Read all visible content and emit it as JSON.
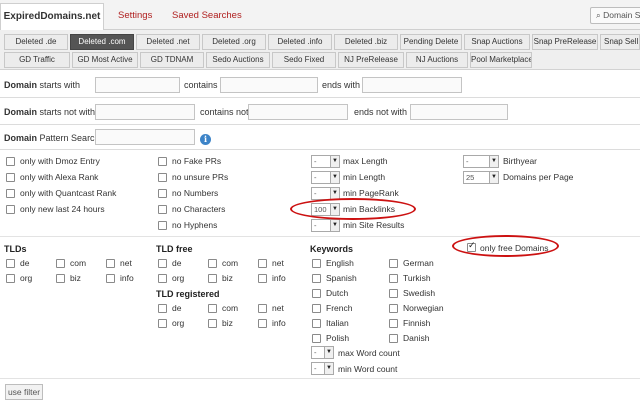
{
  "header": {
    "brand": "ExpiredDomains.net",
    "settings": "Settings",
    "saved_searches": "Saved Searches",
    "domain_search": "Domain S"
  },
  "tabs_row1": [
    "Deleted .de",
    "Deleted .com",
    "Deleted .net",
    "Deleted .org",
    "Deleted .info",
    "Deleted .biz",
    "Pending Delete",
    "Snap Auctions",
    "Snap PreRelease",
    "Snap Sell"
  ],
  "tabs_row2": [
    "GD Traffic",
    "GD Most Active",
    "GD TDNAM",
    "Sedo Auctions",
    "Sedo Fixed",
    "NJ PreRelease",
    "NJ Auctions",
    "Pool Marketplace"
  ],
  "active_tab": "Deleted .com",
  "search": {
    "domain_word": "Domain",
    "starts_with": "starts with",
    "contains": "contains",
    "ends_with": "ends with",
    "starts_not_with": "starts not with",
    "contains_not": "contains not",
    "ends_not_with": "ends not with",
    "pattern_search": "Pattern Search",
    "info_glyph": "i"
  },
  "options_col1": [
    "only with Dmoz Entry",
    "only with Alexa Rank",
    "only with Quantcast Rank",
    "only new last 24 hours"
  ],
  "options_col2": [
    "no Fake PRs",
    "no unsure PRs",
    "no Numbers",
    "no Characters",
    "no Hyphens"
  ],
  "options_col3": [
    {
      "value": "-",
      "label": "max Length"
    },
    {
      "value": "-",
      "label": "min Length"
    },
    {
      "value": "-",
      "label": "min PageRank"
    },
    {
      "value": "100",
      "label": "min Backlinks"
    },
    {
      "value": "-",
      "label": "min Site Results"
    }
  ],
  "options_col4": [
    {
      "value": "-",
      "label": "Birthyear"
    },
    {
      "value": "25",
      "label": "Domains per Page"
    }
  ],
  "tlds": {
    "heading": "TLDs",
    "items": [
      "de",
      "com",
      "net",
      "org",
      "biz",
      "info"
    ]
  },
  "tld_free": {
    "heading": "TLD free",
    "items": [
      "de",
      "com",
      "net",
      "org",
      "biz",
      "info"
    ]
  },
  "tld_registered": {
    "heading": "TLD registered",
    "items": [
      "de",
      "com",
      "net",
      "org",
      "biz",
      "info"
    ]
  },
  "keywords": {
    "heading": "Keywords",
    "col1": [
      "English",
      "Spanish",
      "Dutch",
      "French",
      "Italian",
      "Polish"
    ],
    "col2": [
      "German",
      "Turkish",
      "Swedish",
      "Norwegian",
      "Finnish",
      "Danish"
    ],
    "max_word_count": "max Word count",
    "min_word_count": "min Word count",
    "select_value": "-"
  },
  "only_free_domains": "only free Domains",
  "use_filter": "use filter",
  "arrow_glyph": "▼",
  "colors": {
    "link_red": "#b02020",
    "highlight_red": "#cc1111",
    "active_tab_bg": "#555555",
    "info_blue": "#3d84c8"
  }
}
